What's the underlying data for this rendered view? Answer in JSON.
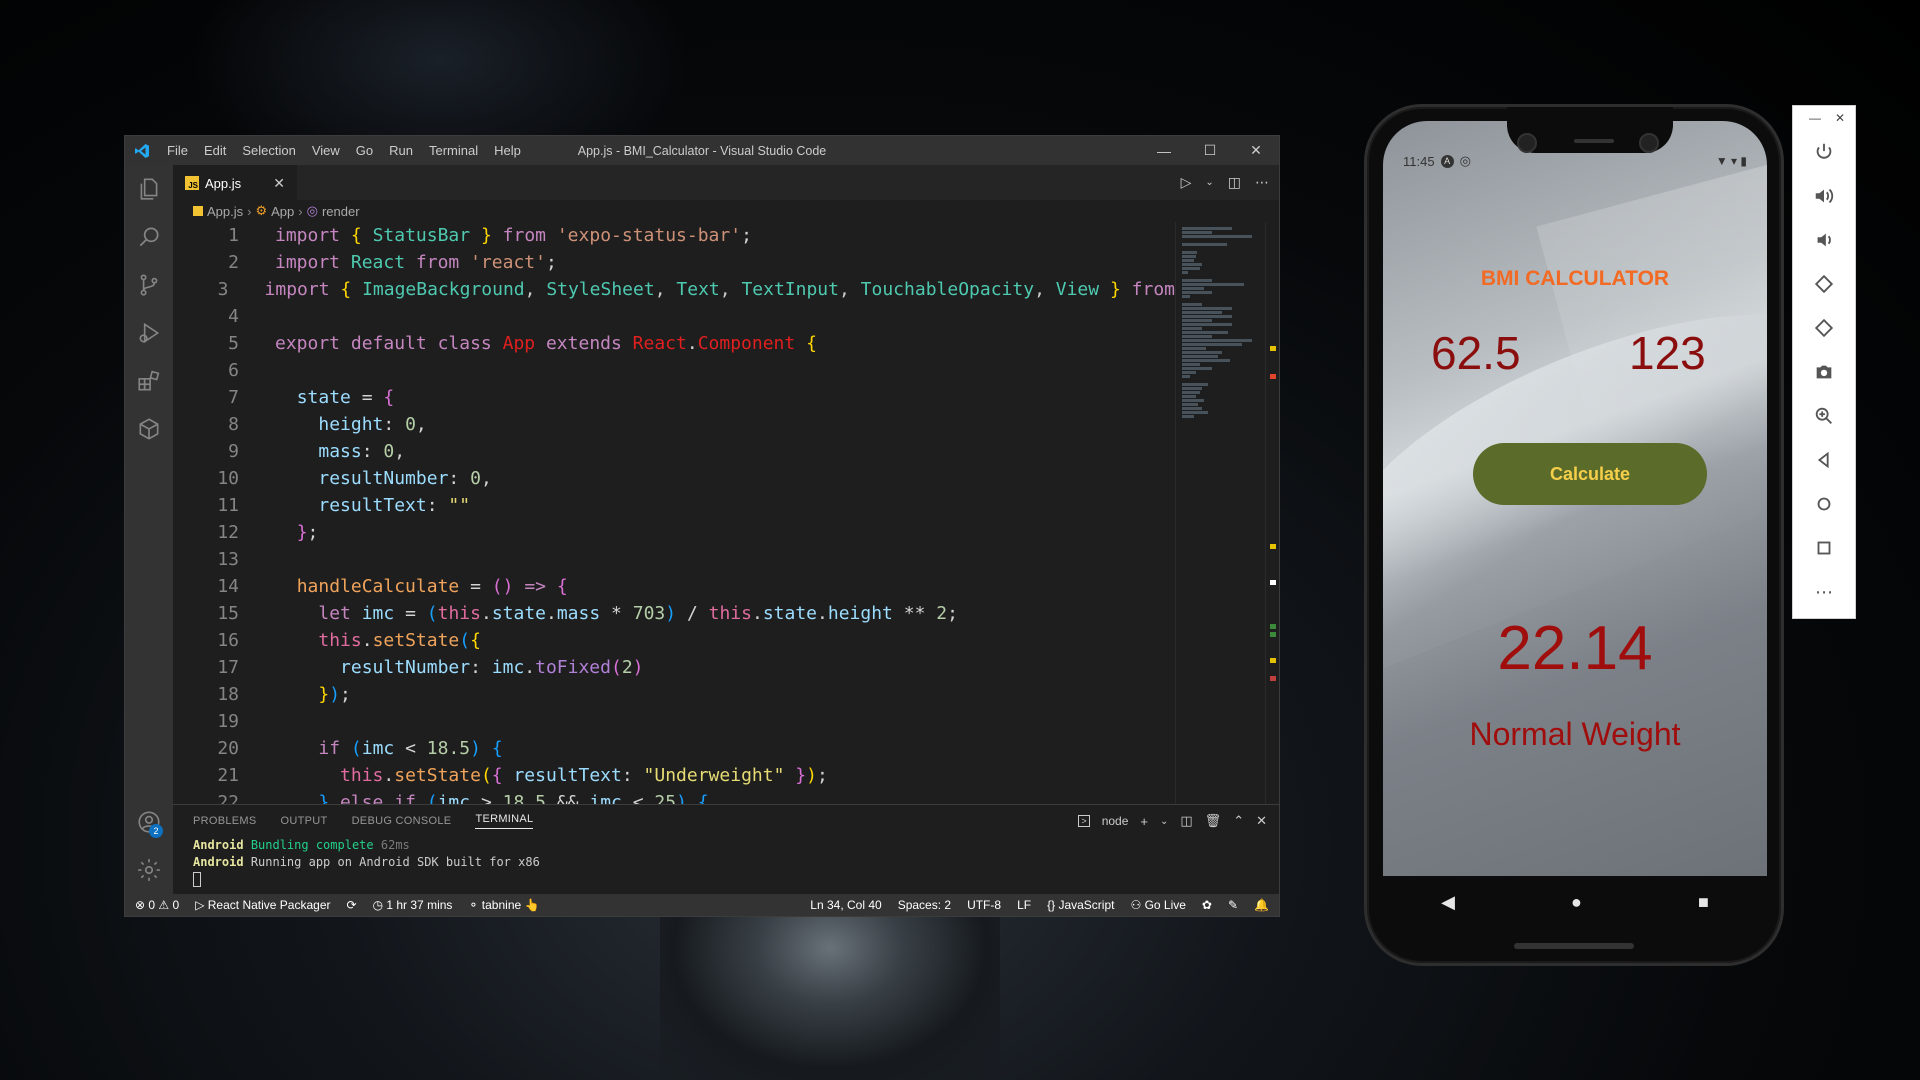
{
  "vscode": {
    "title": "App.js - BMI_Calculator - Visual Studio Code",
    "menu": [
      "File",
      "Edit",
      "Selection",
      "View",
      "Go",
      "Run",
      "Terminal",
      "Help"
    ],
    "tab": {
      "label": "App.js",
      "icon_text": "JS"
    },
    "breadcrumb": [
      "App.js",
      "App",
      "render"
    ],
    "code_lines": [
      "1",
      "2",
      "3",
      "4",
      "5",
      "6",
      "7",
      "8",
      "9",
      "10",
      "11",
      "12",
      "13",
      "14",
      "15",
      "16",
      "17",
      "18",
      "19",
      "20",
      "21",
      "22"
    ],
    "panel_tabs": [
      "PROBLEMS",
      "OUTPUT",
      "DEBUG CONSOLE",
      "TERMINAL"
    ],
    "terminal_shell": "node",
    "terminal": {
      "line1_prefix": "Android",
      "line1_text": "Bundling complete",
      "line1_time": "62ms",
      "line2_prefix": "Android",
      "line2_text": "Running app on Android SDK built for x86"
    },
    "status": {
      "errors": "0",
      "warnings": "0",
      "packager": "React Native Packager",
      "time": "1 hr 37 mins",
      "tabnine": "tabnine",
      "position": "Ln 34, Col 40",
      "spaces": "Spaces: 2",
      "encoding": "UTF-8",
      "eol": "LF",
      "language": "JavaScript",
      "golive": "Go Live"
    }
  },
  "phone": {
    "time": "11:45",
    "title": "BMI CALCULATOR",
    "mass_value": "62.5",
    "height_value": "123",
    "button": "Calculate",
    "result_number": "22.14",
    "result_text": "Normal Weight"
  },
  "colors": {
    "bmi_title": "#f26a23",
    "values": "#8b0e0e",
    "button_bg": "#5b6b2a",
    "button_text": "#f5cf4a"
  }
}
